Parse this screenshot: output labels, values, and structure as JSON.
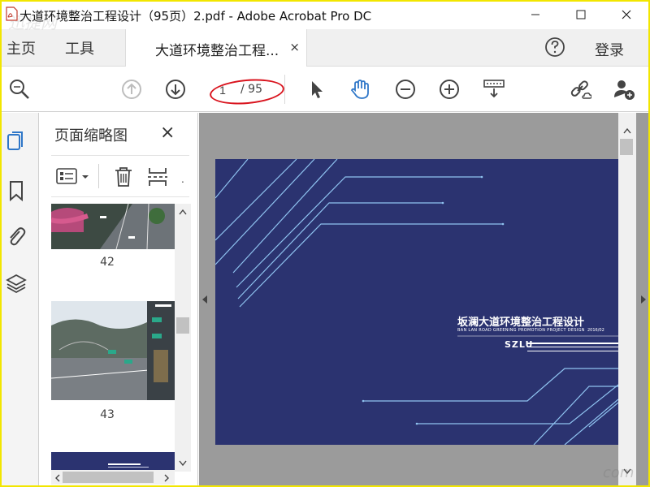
{
  "window": {
    "title": "大道环境整治工程设计（95页）2.pdf - Adobe Acrobat Pro DC",
    "minimize_icon": "minimize-icon",
    "maximize_icon": "maximize-icon",
    "close_icon": "close-icon"
  },
  "tabs": {
    "home": "主页",
    "tools": "工具",
    "document": "大道环境整治工程...",
    "document_close": "×",
    "help_icon": "question-circle-icon",
    "login": "登录"
  },
  "toolbar": {
    "page_current": "1",
    "page_total": "/ 95",
    "annotation_color": "#d9141e",
    "accent": "#2f77c8"
  },
  "thumbnails_panel": {
    "title": "页面缩略图",
    "close": "×",
    "pages": [
      {
        "number": "42"
      },
      {
        "number": "43"
      }
    ]
  },
  "document": {
    "background_color": "#2b3370",
    "title": "坂澜大道环境整治工程设计",
    "subtitle": "BAN LAN ROAD GREENING PROMOTION PROJECT DESIGN",
    "date": "2016/02",
    "logo": "SZLU"
  },
  "watermarks": {
    "top_left": "迅捷网",
    "bottom_right": "com"
  }
}
